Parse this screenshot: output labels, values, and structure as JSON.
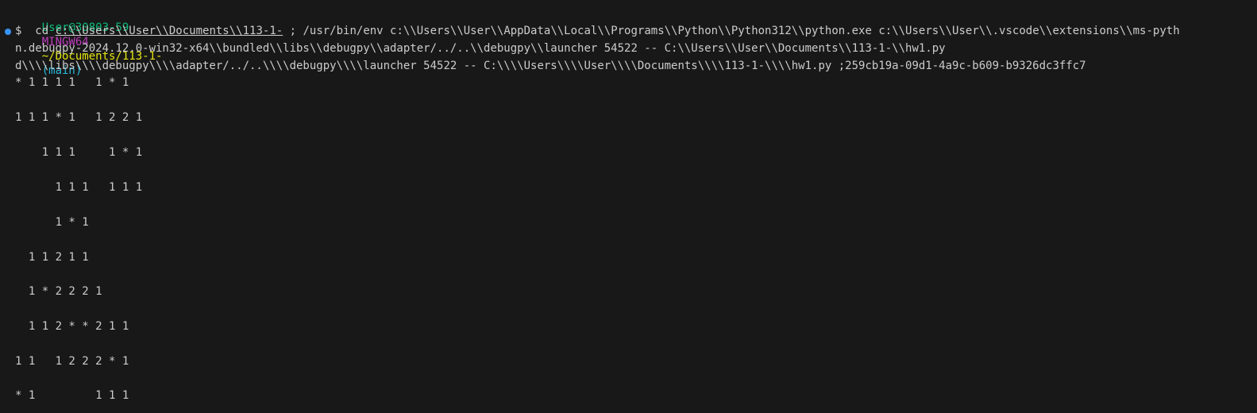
{
  "prompt": {
    "user_host": "User@30803-59",
    "shell": "MINGW64",
    "path": "~/Documents/113-1-",
    "branch": "(main)"
  },
  "command": {
    "dollar": "$",
    "cd": "cd",
    "cd_target": "c:\\\\Users\\\\User\\\\Documents\\\\113-1-",
    "rest_line1": "; /usr/bin/env c:\\\\Users\\\\User\\\\AppData\\\\Local\\\\Programs\\\\Python\\\\Python312\\\\python.exe c:\\\\Users\\\\User\\\\.vscode\\\\extensions\\\\ms-pyth",
    "line2": "n.debugpy-2024.12.0-win32-x64\\\\bundled\\\\libs\\\\debugpy\\\\adapter/../..\\\\debugpy\\\\launcher 54522 -- C:\\\\Users\\\\User\\\\Documents\\\\113-1-\\\\hw1.py",
    "line3": "d\\\\\\\\libs\\\\\\\\debugpy\\\\\\\\adapter/../..\\\\\\\\debugpy\\\\\\\\launcher 54522 -- C:\\\\\\\\Users\\\\\\\\User\\\\\\\\Documents\\\\\\\\113-1-\\\\\\\\hw1.py ;259cb19a-09d1-4a9c-b609-b9326dc3ffc7"
  },
  "output": [
    "* 1 1 1 1   1 * 1",
    "1 1 1 * 1   1 2 2 1",
    "    1 1 1     1 * 1",
    "      1 1 1   1 1 1",
    "      1 * 1",
    "  1 1 2 1 1",
    "  1 * 2 2 2 1",
    "  1 1 2 * * 2 1 1",
    "1 1   1 2 2 2 * 1",
    "* 1         1 1 1"
  ]
}
